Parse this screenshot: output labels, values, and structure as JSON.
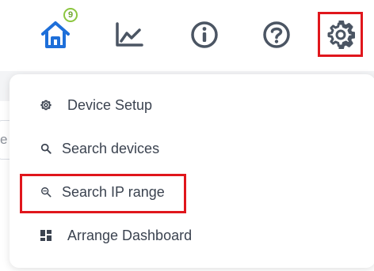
{
  "nav": {
    "items": [
      {
        "name": "home",
        "icon": "home-icon",
        "badge": "9"
      },
      {
        "name": "charts",
        "icon": "line-chart-icon"
      },
      {
        "name": "info",
        "icon": "info-icon"
      },
      {
        "name": "help",
        "icon": "help-icon"
      },
      {
        "name": "settings",
        "icon": "gear-icon"
      }
    ],
    "home_badge": "9",
    "colors": {
      "home": "#1e6fd9",
      "icons": "#4b5563",
      "badge": "#8cc63f",
      "highlight": "#e0161c"
    }
  },
  "background": {
    "search_partial_text": "e for d..."
  },
  "menu": {
    "items": [
      {
        "label": "Device Setup",
        "icon": "gear-icon"
      },
      {
        "label": "Search devices",
        "icon": "search-icon"
      },
      {
        "label": "Search IP range",
        "icon": "search-ip-icon"
      },
      {
        "label": "Arrange Dashboard",
        "icon": "grid-icon"
      }
    ]
  }
}
